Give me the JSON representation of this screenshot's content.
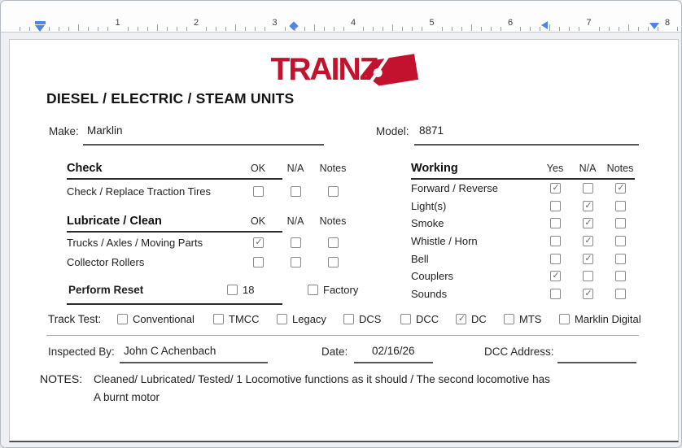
{
  "colors": {
    "brand_red": "#c3122e",
    "marker_blue": "#4b86e8"
  },
  "ruler": {
    "numbers": [
      "1",
      "2",
      "3",
      "4",
      "5",
      "6",
      "7",
      "8"
    ]
  },
  "logo": {
    "text": "TRAINZ",
    "tag_icon": "price-tag"
  },
  "title": "DIESEL / ELECTRIC / STEAM UNITS",
  "make": {
    "label": "Make:",
    "value": "Marklin"
  },
  "model": {
    "label": "Model:",
    "value": "8871"
  },
  "sections": {
    "check": {
      "title": "Check",
      "columns": [
        "OK",
        "N/A",
        "Notes"
      ],
      "rows": [
        {
          "label": "Check / Replace Traction Tires",
          "states": [
            false,
            false,
            false
          ]
        }
      ]
    },
    "lubricate": {
      "title": "Lubricate / Clean",
      "columns": [
        "OK",
        "N/A",
        "Notes"
      ],
      "rows": [
        {
          "label": "Trucks / Axles / Moving Parts",
          "states": [
            true,
            false,
            false
          ]
        },
        {
          "label": "Collector Rollers",
          "states": [
            false,
            false,
            false
          ]
        }
      ]
    },
    "working": {
      "title": "Working",
      "columns": [
        "Yes",
        "N/A",
        "Notes"
      ],
      "rows": [
        {
          "label": "Forward / Reverse",
          "states": [
            true,
            false,
            true
          ]
        },
        {
          "label": "Light(s)",
          "states": [
            false,
            true,
            false
          ]
        },
        {
          "label": "Smoke",
          "states": [
            false,
            true,
            false
          ]
        },
        {
          "label": "Whistle / Horn",
          "states": [
            false,
            true,
            false
          ]
        },
        {
          "label": "Bell",
          "states": [
            false,
            true,
            false
          ]
        },
        {
          "label": "Couplers",
          "states": [
            true,
            false,
            false
          ]
        },
        {
          "label": "Sounds",
          "states": [
            false,
            true,
            false
          ]
        }
      ]
    }
  },
  "perform_reset": {
    "title": "Perform Reset",
    "options": [
      {
        "label": "18",
        "checked": false
      },
      {
        "label": "Factory",
        "checked": false
      }
    ]
  },
  "track_test": {
    "label": "Track Test:",
    "options": [
      {
        "label": "Conventional",
        "checked": false
      },
      {
        "label": "TMCC",
        "checked": false
      },
      {
        "label": "Legacy",
        "checked": false
      },
      {
        "label": "DCS",
        "checked": false
      },
      {
        "label": "DCC",
        "checked": false
      },
      {
        "label": "DC",
        "checked": true
      },
      {
        "label": "MTS",
        "checked": false
      },
      {
        "label": "Marklin Digital",
        "checked": false
      }
    ]
  },
  "footer": {
    "inspected_by": {
      "label": "Inspected By:",
      "value": "John C Achenbach"
    },
    "date": {
      "label": "Date:",
      "value": "02/16/26"
    },
    "dcc_address": {
      "label": "DCC Address:",
      "value": ""
    }
  },
  "notes": {
    "label": "NOTES:",
    "line1": "Cleaned/ Lubricated/ Tested/ 1 Locomotive functions as it should / The second locomotive has",
    "line2": "A burnt motor"
  }
}
